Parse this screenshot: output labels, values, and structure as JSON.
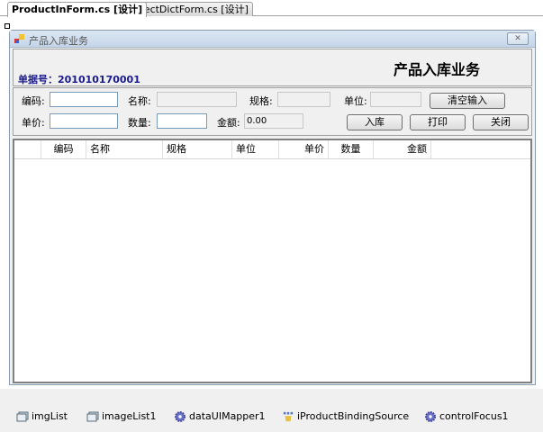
{
  "tabs": [
    {
      "label": "ProductInForm.cs [设计]",
      "active": true
    },
    {
      "label": "SelectDictForm.cs [设计]",
      "active": false
    }
  ],
  "form": {
    "title": "产品入库业务",
    "close_glyph": "✕",
    "bill_no_label": "单据号：",
    "bill_no": "201010170001",
    "header_title": "产品入库业务",
    "fields": {
      "code_label": "编码:",
      "code_value": "",
      "name_label": "名称:",
      "name_value": "",
      "spec_label": "规格:",
      "spec_value": "",
      "unit_label": "单位:",
      "unit_value": "",
      "price_label": "单价:",
      "price_value": "",
      "qty_label": "数量:",
      "qty_value": "",
      "amount_label": "金额:",
      "amount_value": "0.00"
    },
    "buttons": {
      "clear": "清空输入",
      "stock_in": "入库",
      "print": "打印",
      "close": "关闭"
    },
    "grid_columns": [
      "编码",
      "名称",
      "规格",
      "单位",
      "单价",
      "数量",
      "金额"
    ]
  },
  "components": [
    {
      "name": "imgList",
      "icon": "image-list-icon"
    },
    {
      "name": "imageList1",
      "icon": "image-list-icon"
    },
    {
      "name": "dataUIMapper1",
      "icon": "gear-icon"
    },
    {
      "name": "iProductBindingSource",
      "icon": "binding-source-icon"
    },
    {
      "name": "controlFocus1",
      "icon": "gear-icon"
    }
  ],
  "colors": {
    "bill_no": "#1a1a8c",
    "titlebar": "#c5d5e8"
  }
}
